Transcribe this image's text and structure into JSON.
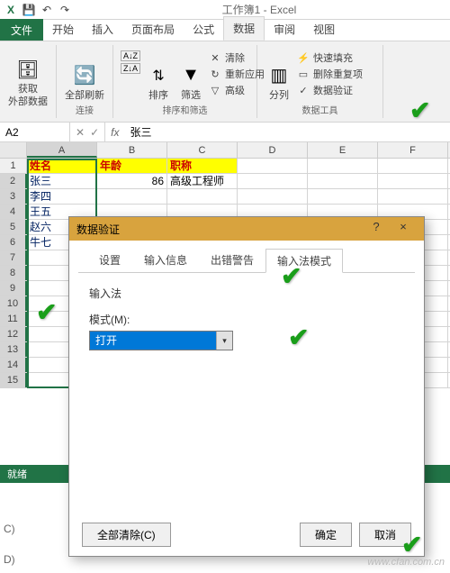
{
  "title": "工作簿1 - Excel",
  "ribbon_tabs": {
    "file": "文件",
    "home": "开始",
    "insert": "插入",
    "layout": "页面布局",
    "formulas": "公式",
    "data": "数据",
    "review": "审阅",
    "view": "视图"
  },
  "ribbon": {
    "get_data": "获取\n外部数据",
    "refresh_all": "全部刷新",
    "connections_group": "连接",
    "sort_az": "A-Z",
    "sort_za": "Z-A",
    "sort": "排序",
    "filter": "筛选",
    "clear": "清除",
    "reapply": "重新应用",
    "advanced": "高级",
    "sort_filter_group": "排序和筛选",
    "text_to_cols": "分列",
    "flash_fill": "快速填充",
    "remove_dup": "删除重复项",
    "data_validation": "数据验证",
    "data_tools_group": "数据工具"
  },
  "name_box": "A2",
  "formula_value": "张三",
  "columns": [
    "A",
    "B",
    "C",
    "D",
    "E",
    "F"
  ],
  "headers": {
    "name": "姓名",
    "age": "年龄",
    "title": "职称"
  },
  "rows": [
    {
      "n": 1
    },
    {
      "n": 2,
      "name": "张三",
      "age": "86",
      "title": "高级工程师"
    },
    {
      "n": 3,
      "name": "李四"
    },
    {
      "n": 4,
      "name": "王五"
    },
    {
      "n": 5,
      "name": "赵六"
    },
    {
      "n": 6,
      "name": "牛七"
    },
    {
      "n": 7
    },
    {
      "n": 8
    },
    {
      "n": 9
    },
    {
      "n": 10
    },
    {
      "n": 11
    },
    {
      "n": 12
    },
    {
      "n": 13
    },
    {
      "n": 14
    },
    {
      "n": 15
    }
  ],
  "dialog": {
    "title": "数据验证",
    "tabs": {
      "settings": "设置",
      "input_msg": "输入信息",
      "error": "出错警告",
      "ime": "输入法模式"
    },
    "section": "输入法",
    "mode_label": "模式(M):",
    "mode_value": "打开",
    "clear_all": "全部清除(C)",
    "ok": "确定",
    "cancel": "取消",
    "help": "?",
    "close": "×"
  },
  "status": "就绪",
  "watermark": "www.cfan.com.cn",
  "bottom1": "C)",
  "bottom2": "D)"
}
